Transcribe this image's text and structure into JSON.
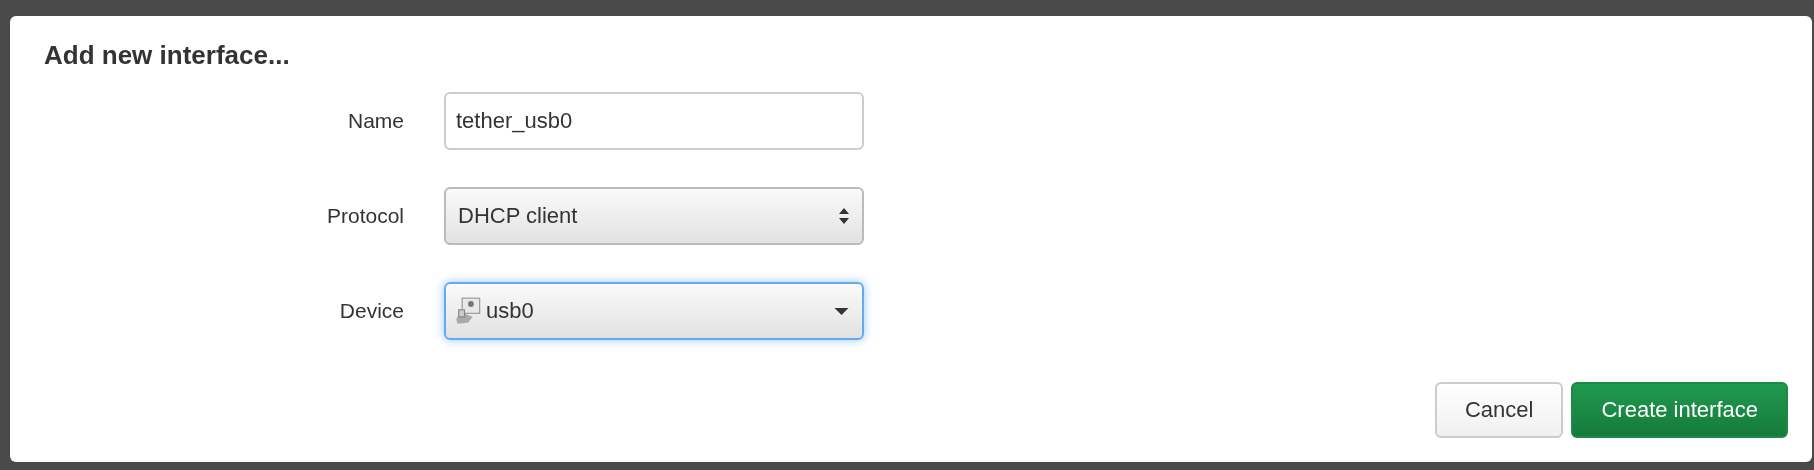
{
  "dialog": {
    "title": "Add new interface...",
    "fields": [
      {
        "kind": "text",
        "label": "Name",
        "value": "tether_usb0",
        "focused": false
      },
      {
        "kind": "spinner-select",
        "label": "Protocol",
        "value": "DHCP client",
        "focused": false
      },
      {
        "kind": "device-select",
        "label": "Device",
        "value": "usb0",
        "focused": true
      }
    ],
    "buttons": [
      {
        "kind": "secondary",
        "label": "Cancel"
      },
      {
        "kind": "primary",
        "label": "Create interface"
      }
    ]
  }
}
